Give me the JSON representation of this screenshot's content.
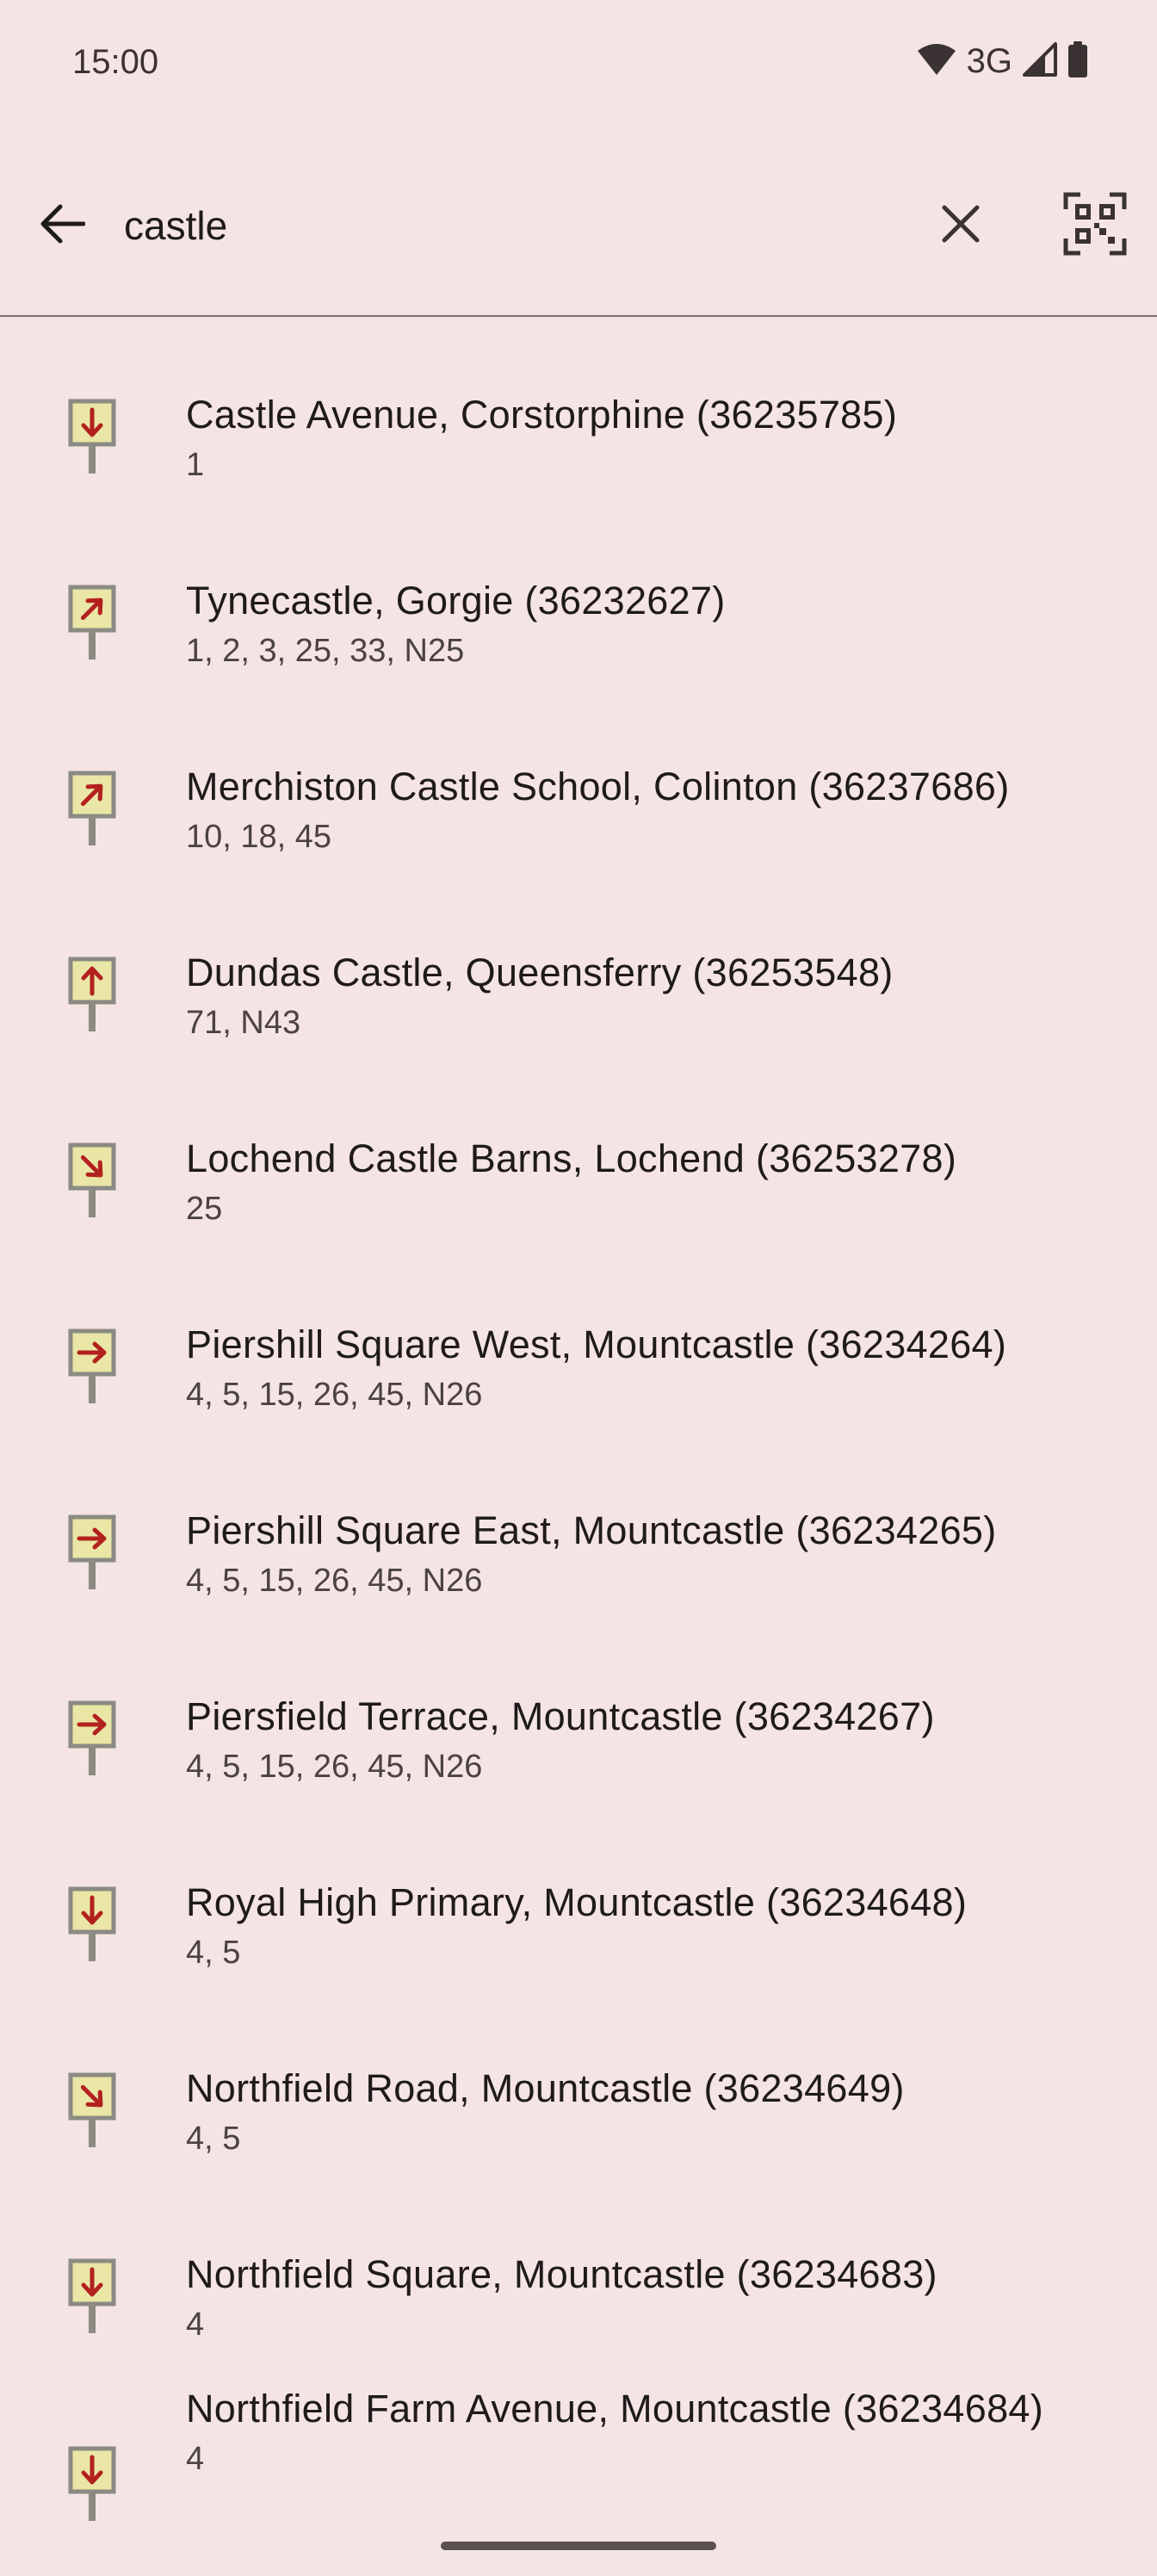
{
  "status": {
    "time": "15:00",
    "network": "3G",
    "icons": [
      "wifi-icon",
      "cell-signal-icon",
      "battery-icon"
    ]
  },
  "search": {
    "query": "castle",
    "back_icon": "arrow-left-icon",
    "clear_icon": "close-icon",
    "qr_icon": "qr-code-scan-icon"
  },
  "colors": {
    "background": "#f5e4e4",
    "stop_sign_fill": "#e9e6a6",
    "stop_sign_border": "#8b8b83",
    "arrow": "#b3211f",
    "divider": "#7a6e70"
  },
  "results": [
    {
      "name": "Castle Avenue, Corstorphine (36235785)",
      "services": "1",
      "direction": "down"
    },
    {
      "name": "Tynecastle, Gorgie (36232627)",
      "services": "1, 2, 3, 25, 33, N25",
      "direction": "up-right"
    },
    {
      "name": "Merchiston Castle School, Colinton (36237686)",
      "services": "10, 18, 45",
      "direction": "up-right"
    },
    {
      "name": "Dundas Castle, Queensferry (36253548)",
      "services": "71, N43",
      "direction": "up"
    },
    {
      "name": "Lochend Castle Barns, Lochend (36253278)",
      "services": "25",
      "direction": "down-right"
    },
    {
      "name": "Piershill Square West, Mountcastle (36234264)",
      "services": "4, 5, 15, 26, 45, N26",
      "direction": "right"
    },
    {
      "name": "Piershill Square East, Mountcastle (36234265)",
      "services": "4, 5, 15, 26, 45, N26",
      "direction": "right"
    },
    {
      "name": "Piersfield Terrace, Mountcastle (36234267)",
      "services": "4, 5, 15, 26, 45, N26",
      "direction": "right"
    },
    {
      "name": "Royal High Primary, Mountcastle (36234648)",
      "services": "4, 5",
      "direction": "down"
    },
    {
      "name": "Northfield Road, Mountcastle (36234649)",
      "services": "4, 5",
      "direction": "down-right"
    },
    {
      "name": "Northfield Square, Mountcastle (36234683)",
      "services": "4",
      "direction": "down"
    },
    {
      "name": "Northfield Farm Avenue, Mountcastle (36234684)",
      "services": "4",
      "direction": "down"
    }
  ]
}
